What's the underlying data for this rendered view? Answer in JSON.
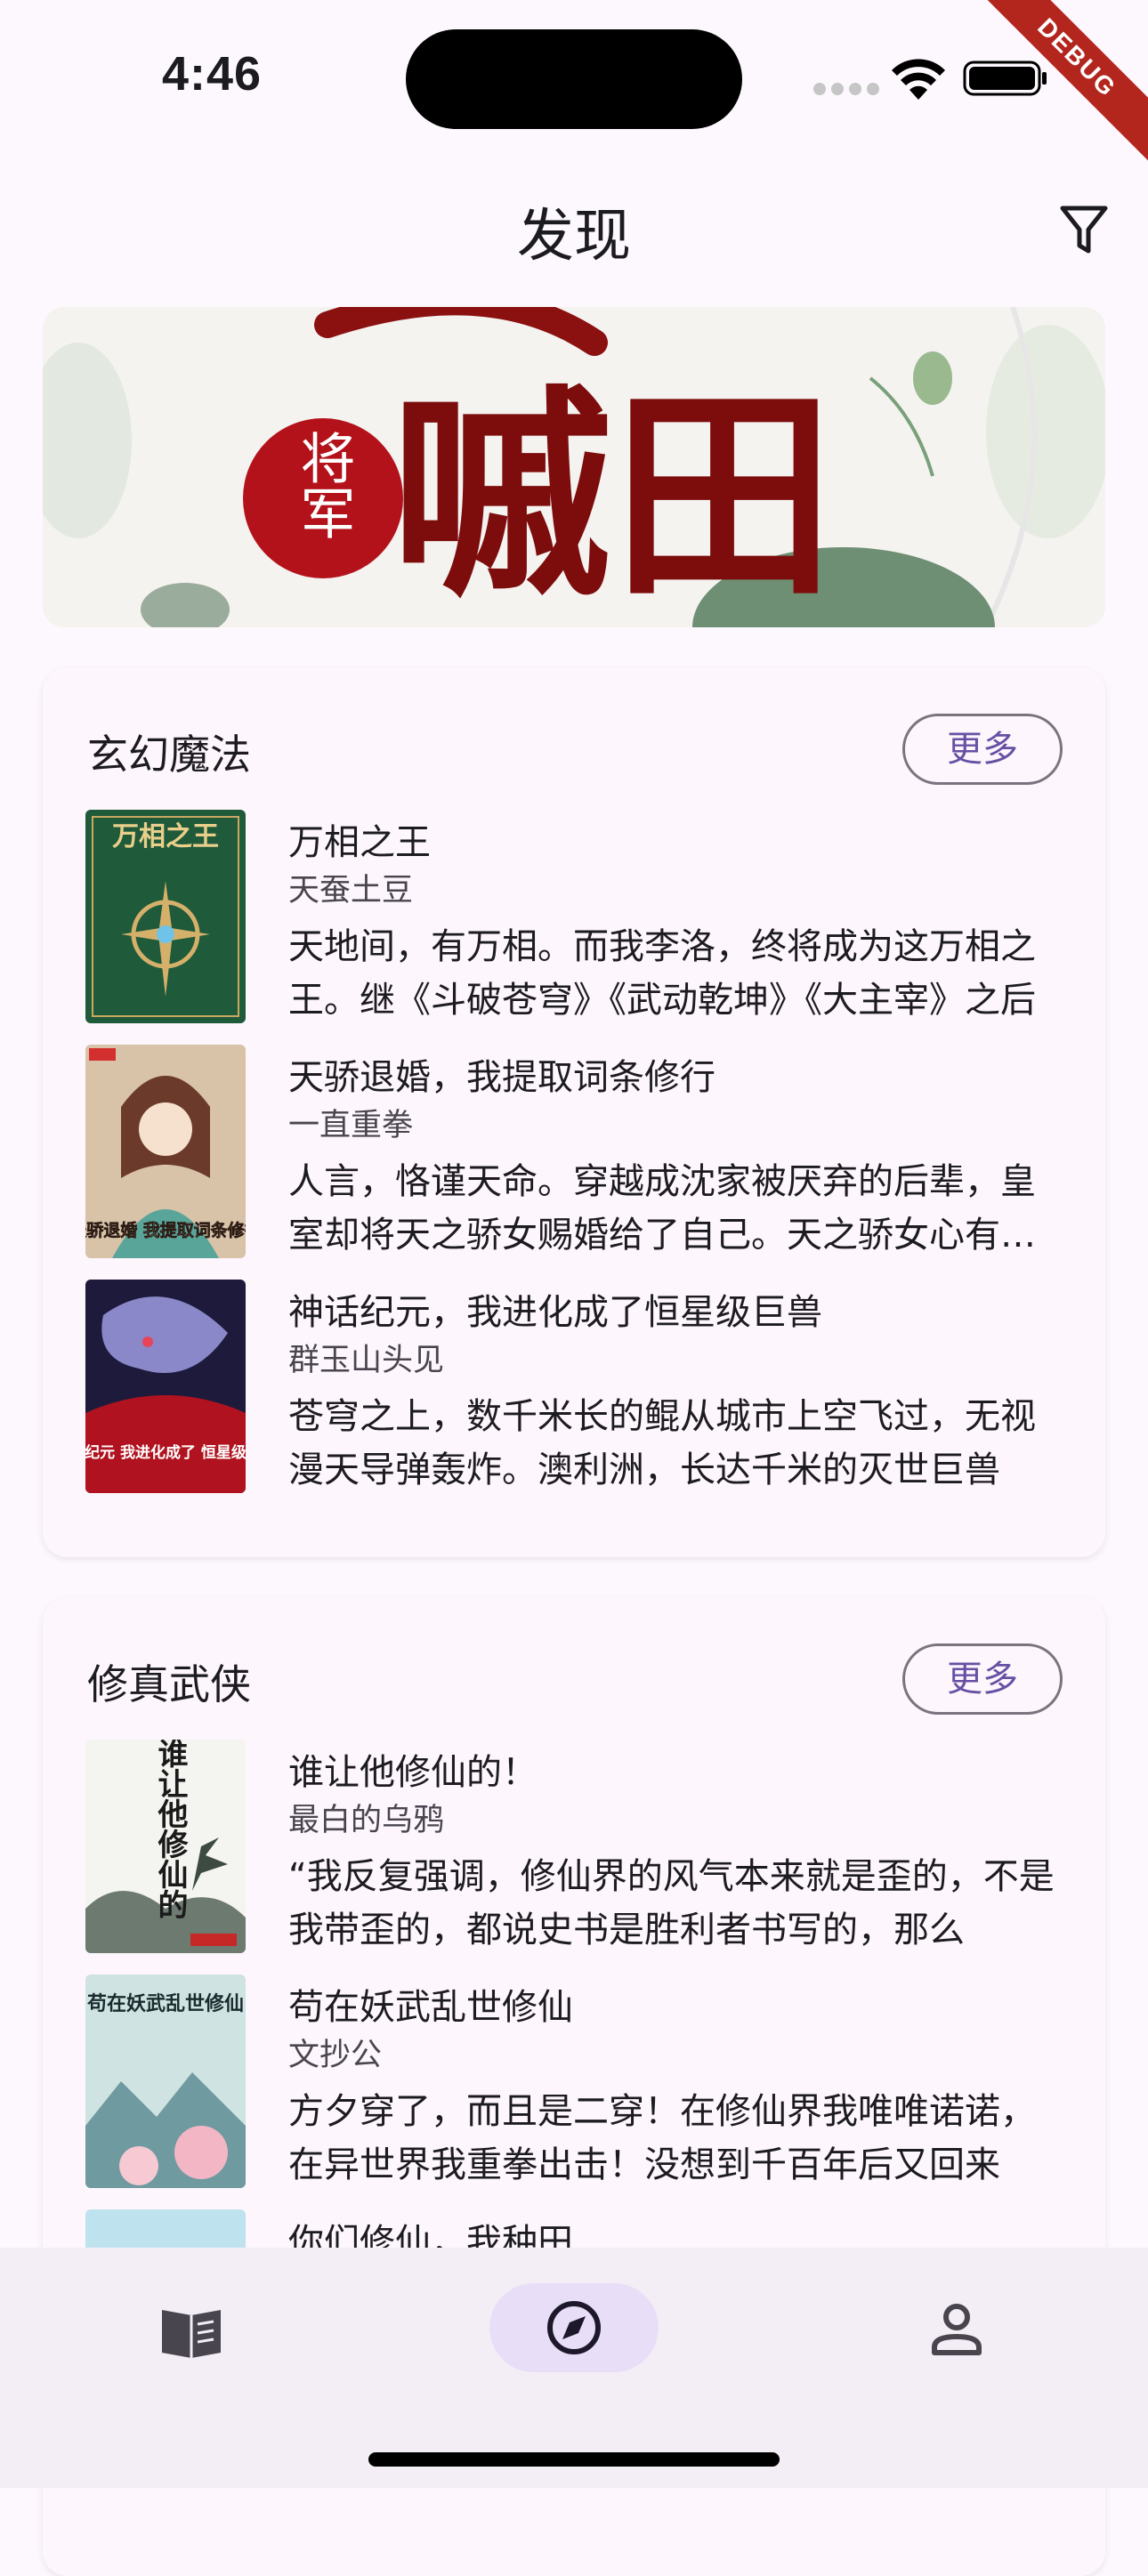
{
  "status_bar": {
    "time": "4:46",
    "debug_label": "DEBUG"
  },
  "header": {
    "title": "发现"
  },
  "sections": [
    {
      "title": "玄幻魔法",
      "more_label": "更多",
      "books": [
        {
          "title": "万相之王",
          "author": "天蚕土豆",
          "description": "天地间，有万相。而我李洛，终将成为这万相之王。继《斗破苍穹》《武动乾坤》《大主宰》之后"
        },
        {
          "title": "天骄退婚，我提取词条修行",
          "author": "一直重拳",
          "description": "人言，恪谨天命。穿越成沈家被厌弃的后辈，皇室却将天之骄女赐婚给了自己。天之骄女心有不甘"
        },
        {
          "title": "神话纪元，我进化成了恒星级巨兽",
          "author": "群玉山头见",
          "description": "苍穹之上，数千米长的鲲从城市上空飞过，无视漫天导弹轰炸。澳利洲，长达千米的灭世巨兽"
        }
      ]
    },
    {
      "title": "修真武侠",
      "more_label": "更多",
      "books": [
        {
          "title": "谁让他修仙的！",
          "author": "最白的乌鸦",
          "description": "“我反复强调，修仙界的风气本来就是歪的，不是我带歪的，都说史书是胜利者书写的，那么"
        },
        {
          "title": "苟在妖武乱世修仙",
          "author": "文抄公",
          "description": "方夕穿了，而且是二穿！在修仙界我唯唯诺诺，在异世界我重拳出击！没想到千百年后又回来"
        },
        {
          "title": "你们修仙，我种田",
          "author": "",
          "description": ""
        }
      ]
    }
  ],
  "covers": [
    {
      "text": "万相之王",
      "bg": "#1f5a3a"
    },
    {
      "text": "天骄退婚 我提取词条修行",
      "bg": "#c9a27a"
    },
    {
      "text": "神话纪元 我进化成了 恒星级巨兽",
      "bg": "#2a2352"
    },
    {
      "text": "谁让他修仙的",
      "bg": "#f2f2ee"
    },
    {
      "text": "苟在妖武乱世修仙",
      "bg": "#9ec5c9"
    },
    {
      "text": "",
      "bg": "#bfe3ee"
    }
  ],
  "banner": {
    "text_main": "嘁田",
    "text_seal": "将军"
  },
  "bottom_nav": {
    "items": [
      {
        "icon": "book-icon",
        "active": false
      },
      {
        "icon": "compass-icon",
        "active": true
      },
      {
        "icon": "person-icon",
        "active": false
      }
    ]
  },
  "colors": {
    "accent": "#6750a4",
    "nav_active": "#e8def8",
    "background": "#fdf8fd"
  }
}
